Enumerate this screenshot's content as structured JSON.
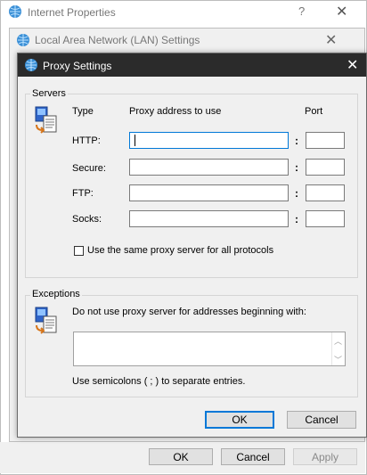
{
  "internet_properties": {
    "title": "Internet Properties",
    "help_glyph": "?",
    "close_glyph": "✕",
    "ok_label": "OK",
    "cancel_label": "Cancel",
    "apply_label": "Apply"
  },
  "lan_settings": {
    "title": "Local Area Network (LAN) Settings",
    "close_glyph": "✕"
  },
  "proxy_settings": {
    "title": "Proxy Settings",
    "close_glyph": "✕",
    "servers": {
      "group_label": "Servers",
      "type_header": "Type",
      "address_header": "Proxy address to use",
      "port_header": "Port",
      "colon": ":",
      "rows": [
        {
          "label": "HTTP:",
          "address": "",
          "port": ""
        },
        {
          "label": "Secure:",
          "address": "",
          "port": ""
        },
        {
          "label": "FTP:",
          "address": "",
          "port": ""
        },
        {
          "label": "Socks:",
          "address": "",
          "port": ""
        }
      ],
      "same_proxy_label": "Use the same proxy server for all protocols",
      "same_proxy_checked": false
    },
    "exceptions": {
      "group_label": "Exceptions",
      "instruction": "Do not use proxy server for addresses beginning with:",
      "value": "",
      "hint": "Use semicolons ( ; ) to separate entries."
    },
    "ok_label": "OK",
    "cancel_label": "Cancel"
  }
}
